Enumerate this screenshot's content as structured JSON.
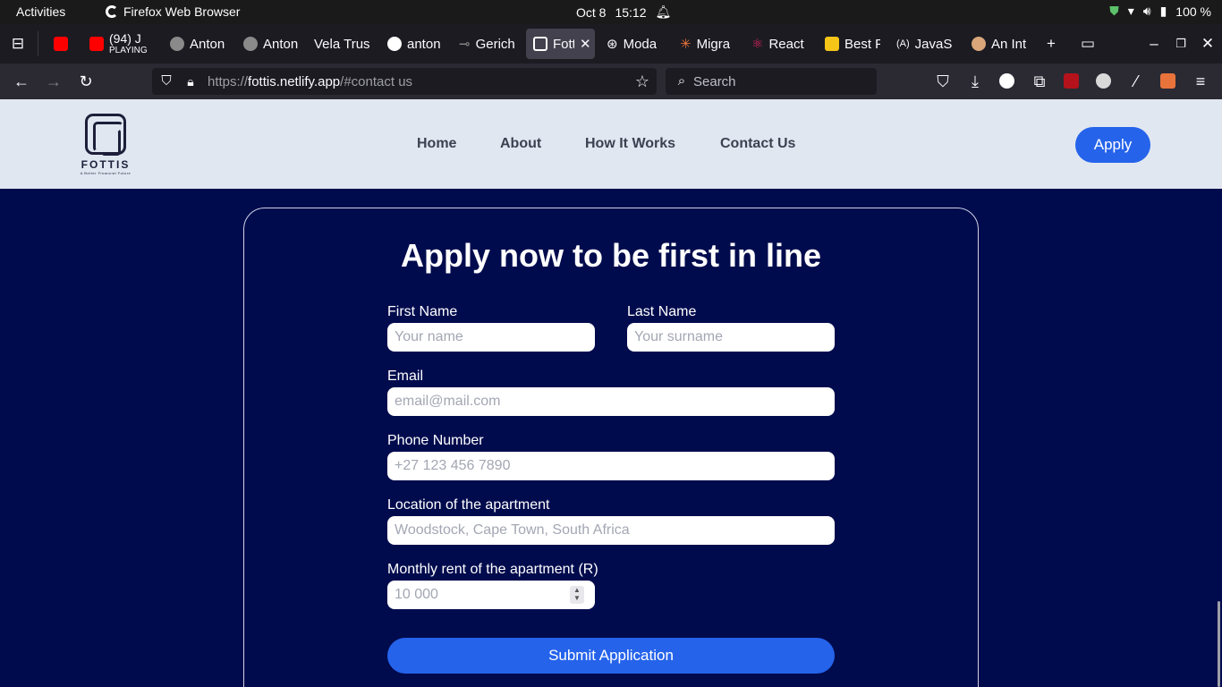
{
  "system": {
    "activities": "Activities",
    "app_name": "Firefox Web Browser",
    "date": "Oct 8",
    "time": "15:12",
    "battery": "100 %"
  },
  "tabs": [
    {
      "label": "(94) J",
      "sub": "PLAYING",
      "color": "#ff0000"
    },
    {
      "label": "Anton",
      "color": "#8a8a8a"
    },
    {
      "label": "Anton",
      "color": "#8a8a8a"
    },
    {
      "label": "Vela Trus",
      "color": ""
    },
    {
      "label": "anton",
      "color": "#ffffff"
    },
    {
      "label": "Gerich",
      "color": "#888888"
    },
    {
      "label": "Fotti",
      "color": "#ffffff"
    },
    {
      "label": "Moda",
      "color": "#ffffff"
    },
    {
      "label": "Migra",
      "color": "#e8743b"
    },
    {
      "label": "React",
      "color": "#e0245e"
    },
    {
      "label": "Best F",
      "color": "#f5c518"
    },
    {
      "label": "JavaS",
      "color": "#7a86ff"
    },
    {
      "label": "An Int",
      "color": "#d9a77a"
    }
  ],
  "url": {
    "prefix": "https://",
    "domain": "fottis.netlify.app",
    "path": "/#contact us"
  },
  "search": {
    "placeholder": "Search"
  },
  "site": {
    "logo_word": "FOTTIS",
    "logo_tagline": "A Better Financial Future",
    "nav": [
      "Home",
      "About",
      "How It Works",
      "Contact Us"
    ],
    "apply": "Apply"
  },
  "form": {
    "title": "Apply now to be first in line",
    "first_name": {
      "label": "First Name",
      "placeholder": "Your name"
    },
    "last_name": {
      "label": "Last Name",
      "placeholder": "Your surname"
    },
    "email": {
      "label": "Email",
      "placeholder": "email@mail.com"
    },
    "phone": {
      "label": "Phone Number",
      "placeholder": "+27 123 456 7890"
    },
    "location": {
      "label": "Location of the apartment",
      "placeholder": "Woodstock, Cape Town, South Africa"
    },
    "rent": {
      "label": "Monthly rent of the apartment (R)",
      "placeholder": "10 000"
    },
    "submit": "Submit Application"
  },
  "colors": {
    "page_bg": "#000b4d",
    "accent": "#2563eb",
    "header_bg": "#e1e7f1"
  }
}
